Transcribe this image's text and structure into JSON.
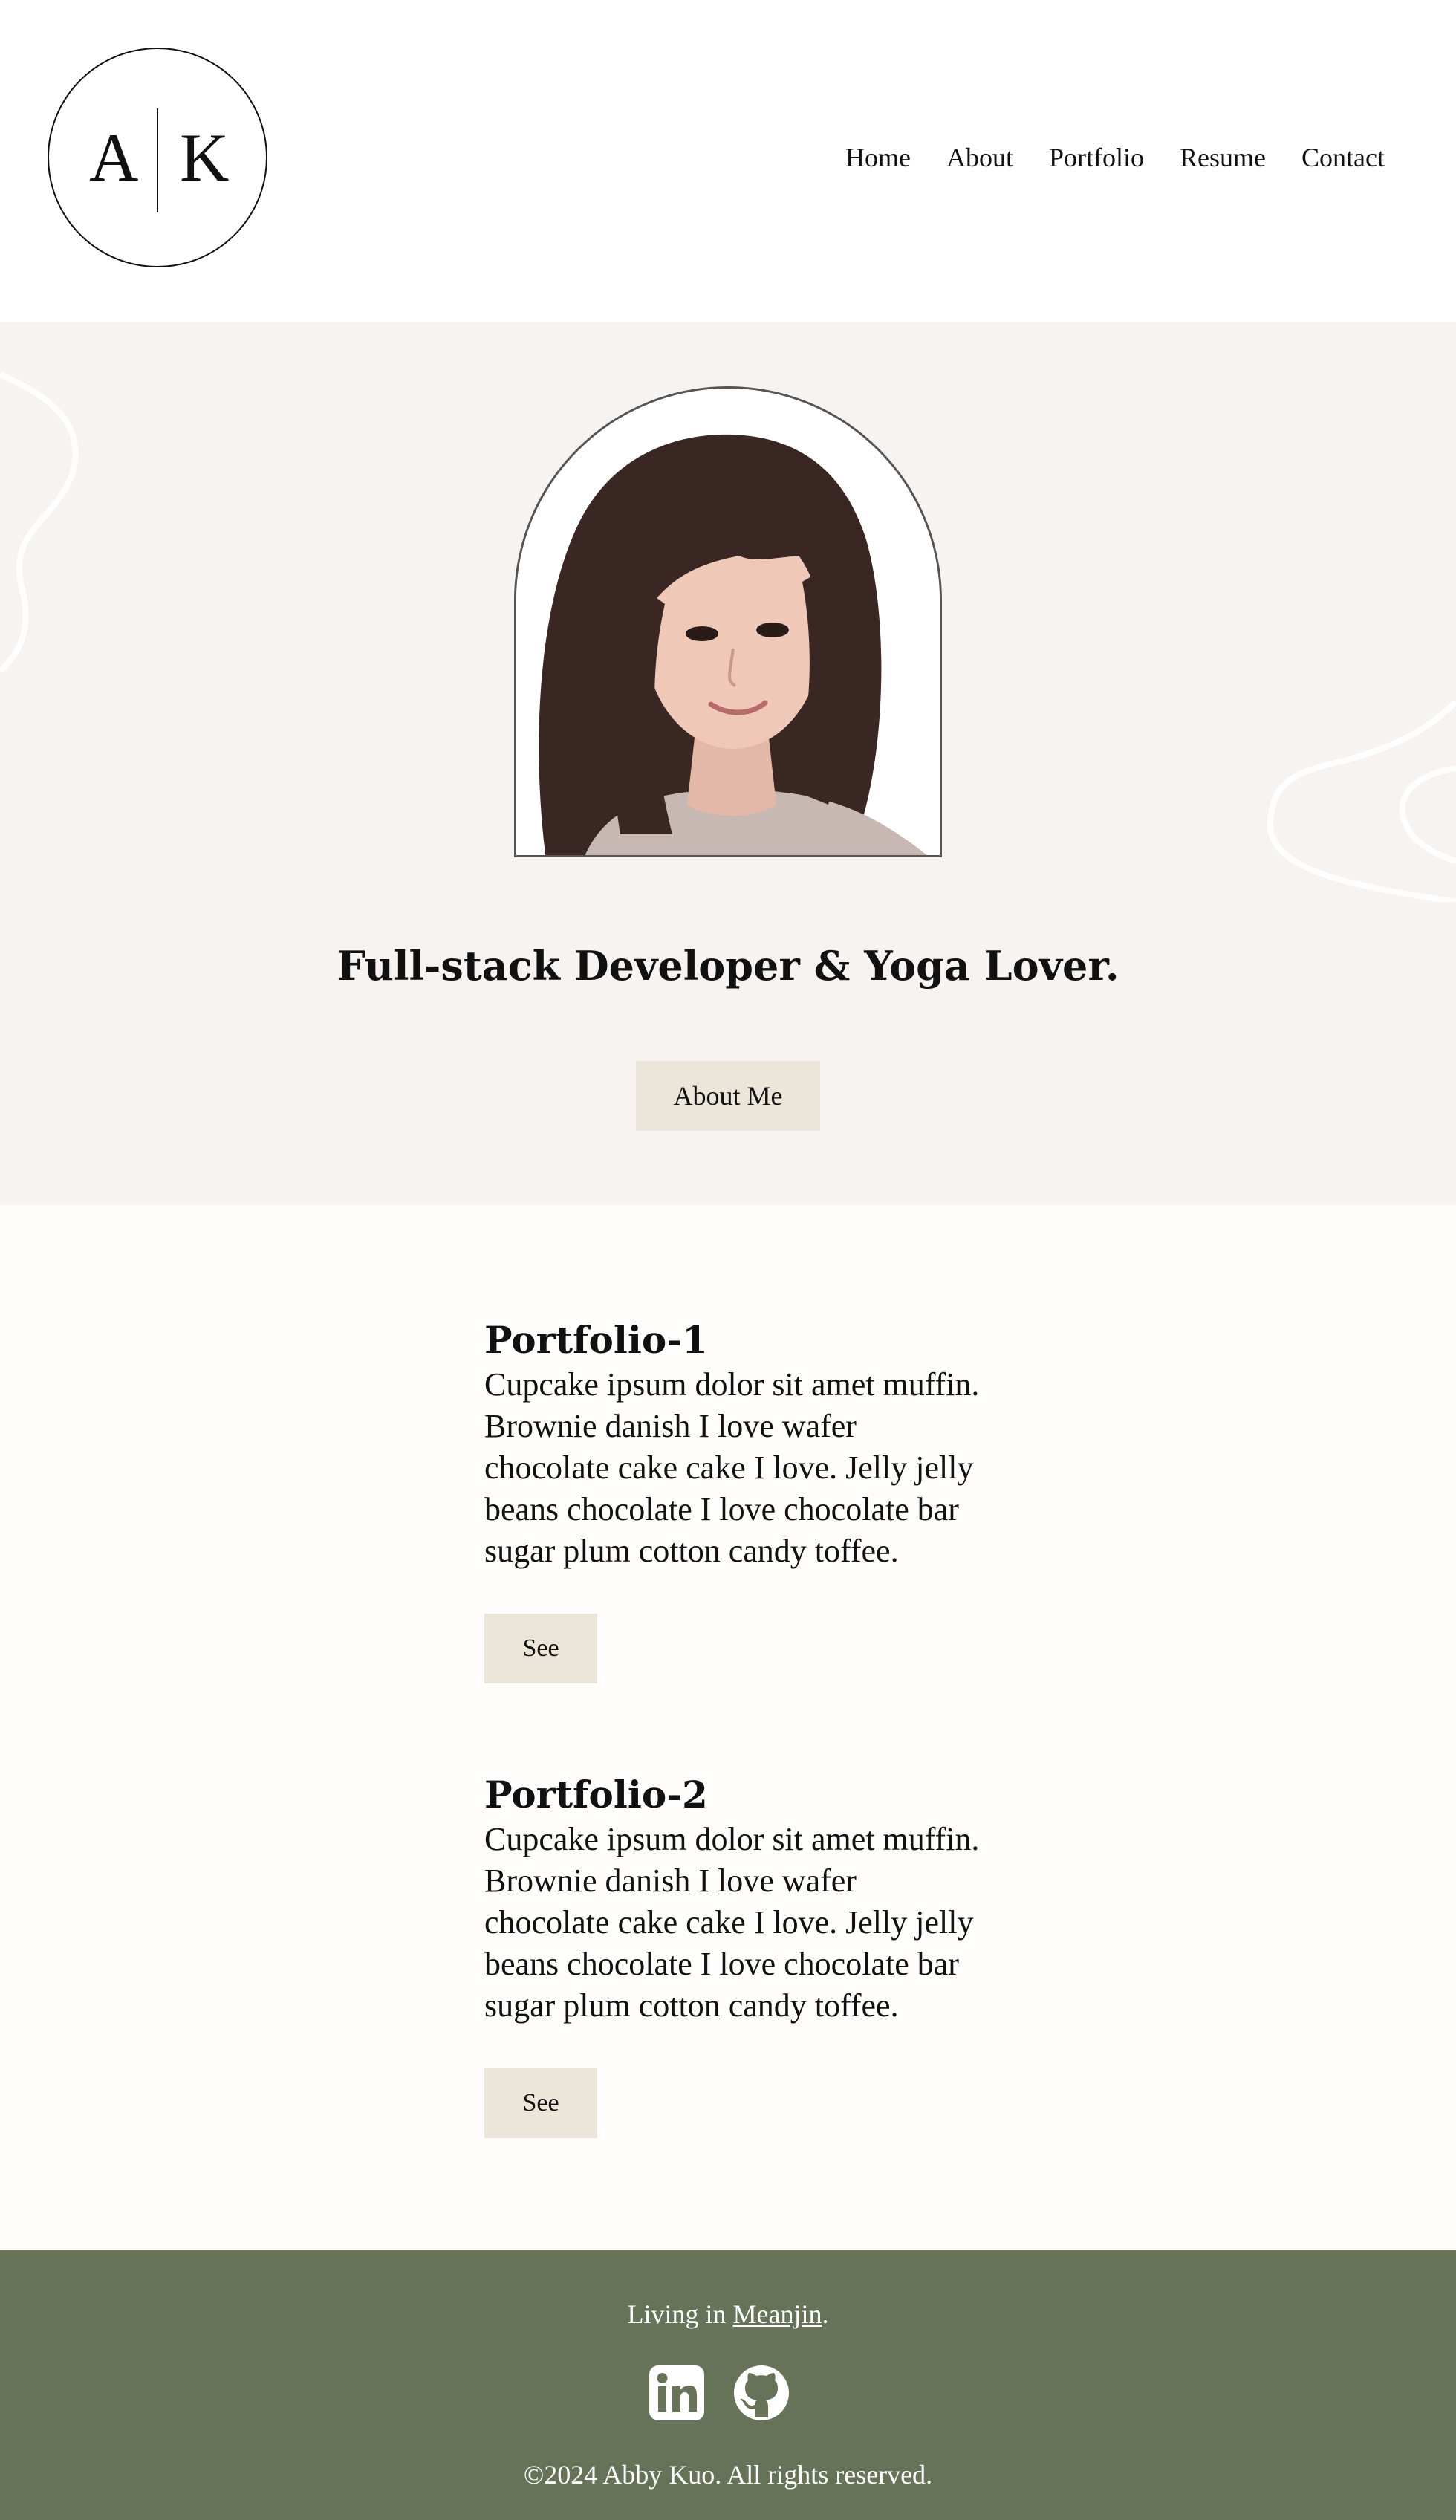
{
  "header": {
    "logo": {
      "letter_left": "A",
      "letter_right": "K"
    },
    "nav": [
      "Home",
      "About",
      "Portfolio",
      "Resume",
      "Contact"
    ]
  },
  "hero": {
    "title": "Full-stack Developer & Yoga Lover.",
    "button_label": "About Me",
    "portrait_icon": "profile-photo",
    "background_color": "#f6f3f1"
  },
  "portfolio": [
    {
      "title": "Portfolio-1",
      "description": "Cupcake ipsum dolor sit amet muffin. Brownie danish I love wafer chocolate cake cake I love. Jelly jelly beans chocolate I love chocolate bar sugar plum cotton candy toffee.",
      "button_label": "See"
    },
    {
      "title": "Portfolio-2",
      "description": "Cupcake ipsum dolor sit amet muffin. Brownie danish I love wafer chocolate cake cake I love. Jelly jelly beans chocolate I love chocolate bar sugar plum cotton candy toffee.",
      "button_label": "See"
    }
  ],
  "footer": {
    "living_prefix": "Living in ",
    "location": "Meanjin",
    "living_suffix": ".",
    "social_icons": [
      "linkedin-icon",
      "github-icon"
    ],
    "copyright": "©2024 Abby Kuo. All rights reserved.",
    "background_color": "#667358"
  },
  "colors": {
    "button_bg": "#ece5da",
    "text": "#111111"
  }
}
